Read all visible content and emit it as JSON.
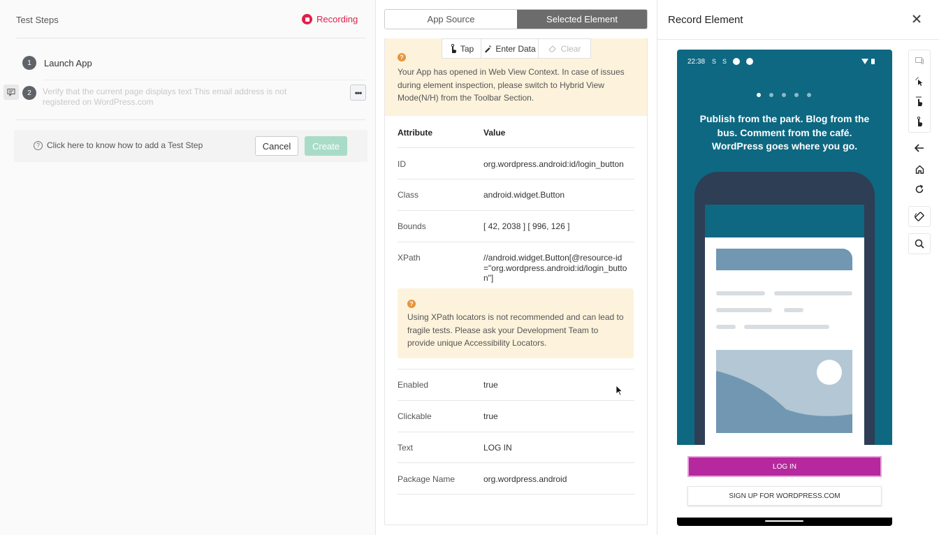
{
  "left": {
    "title": "Test Steps",
    "recording": "Recording",
    "steps": [
      {
        "num": "1",
        "text": "Launch App"
      },
      {
        "num": "2",
        "text": "Verify that the current page displays text This email address is not registered on WordPress.com"
      }
    ],
    "help": "Click here to know how to add a Test Step",
    "cancel": "Cancel",
    "create": "Create"
  },
  "mid": {
    "tabs": [
      "App Source",
      "Selected Element"
    ],
    "actions": [
      "Tap",
      "Enter Data",
      "Clear"
    ],
    "webview_warning": "Your App has opened in Web View Context. In case of issues during element inspection, please switch to Hybrid View Mode(N/H) from the Toolbar Section.",
    "header": {
      "attr": "Attribute",
      "value": "Value"
    },
    "rows": [
      {
        "k": "ID",
        "v": "org.wordpress.android:id/login_button"
      },
      {
        "k": "Class",
        "v": "android.widget.Button"
      },
      {
        "k": "Bounds",
        "v": "[ 42, 2038 ] [ 996, 126 ]"
      },
      {
        "k": "XPath",
        "v": "//android.widget.Button[@resource-id =\"org.wordpress.android:id/login_butto n\"]"
      },
      {
        "k": "Enabled",
        "v": "true"
      },
      {
        "k": "Clickable",
        "v": "true"
      },
      {
        "k": "Text",
        "v": "LOG IN"
      },
      {
        "k": "Package Name",
        "v": "org.wordpress.android"
      }
    ],
    "xpath_warning": "Using XPath locators is not recommended and can lead to fragile tests. Please ask your Development Team to provide unique Accessibility Locators."
  },
  "right": {
    "title": "Record Element",
    "device": {
      "time": "22:38",
      "tagline": "Publish from the park. Blog from the bus. Comment from the café. WordPress goes where you go.",
      "login": "LOG IN",
      "signup": "SIGN UP FOR WORDPRESS.COM"
    }
  },
  "colors": {
    "accent": "#e0204a",
    "create": "#a8dcc8",
    "device_bg": "#0e6882",
    "login": "#b5289e",
    "warn_bg": "#fdf3dc"
  }
}
